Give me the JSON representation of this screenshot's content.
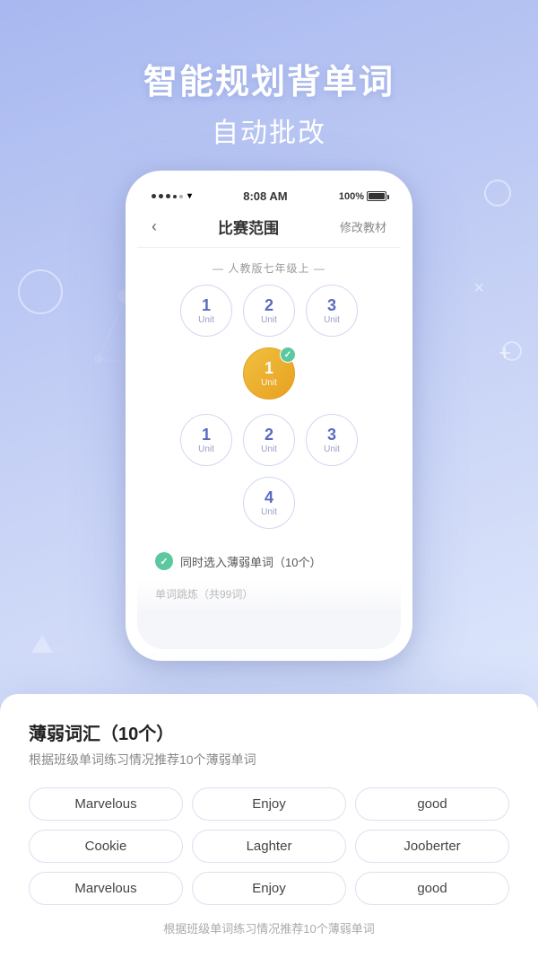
{
  "background": {
    "gradient_start": "#a8b8f0",
    "gradient_end": "#e8eeff"
  },
  "header": {
    "title_line1": "智能规划背单词",
    "title_line2": "自动批改"
  },
  "phone": {
    "status_bar": {
      "time": "8:08 AM",
      "battery": "100%"
    },
    "nav": {
      "back_label": "‹",
      "title": "比赛范围",
      "action": "修改教材"
    },
    "section_label": "— 人教版七年级上 —",
    "row1_units": [
      {
        "number": "1",
        "label": "Unit",
        "selected": false
      },
      {
        "number": "2",
        "label": "Unit",
        "selected": false
      },
      {
        "number": "3",
        "label": "Unit",
        "selected": false
      },
      {
        "number": "1",
        "label": "Unit",
        "selected": true,
        "checked": true
      }
    ],
    "row2_units": [
      {
        "number": "1",
        "label": "Unit",
        "selected": false
      },
      {
        "number": "2",
        "label": "Unit",
        "selected": false
      },
      {
        "number": "3",
        "label": "Unit",
        "selected": false
      },
      {
        "number": "4",
        "label": "Unit",
        "selected": false
      }
    ],
    "checkbox_text": "同时选入薄弱单词（10个）",
    "bottom_text": "单词跳炼（共99词）"
  },
  "bottom_sheet": {
    "title": "薄弱词汇（10个）",
    "description": "根据班级单词练习情况推荐10个薄弱单词",
    "words": [
      [
        "Marvelous",
        "Enjoy",
        "good"
      ],
      [
        "Cookie",
        "Laghter",
        "Jooberter"
      ],
      [
        "Marvelous",
        "Enjoy",
        "good"
      ]
    ],
    "footer": "根据班级单词练习情况推荐10个薄弱单词"
  }
}
